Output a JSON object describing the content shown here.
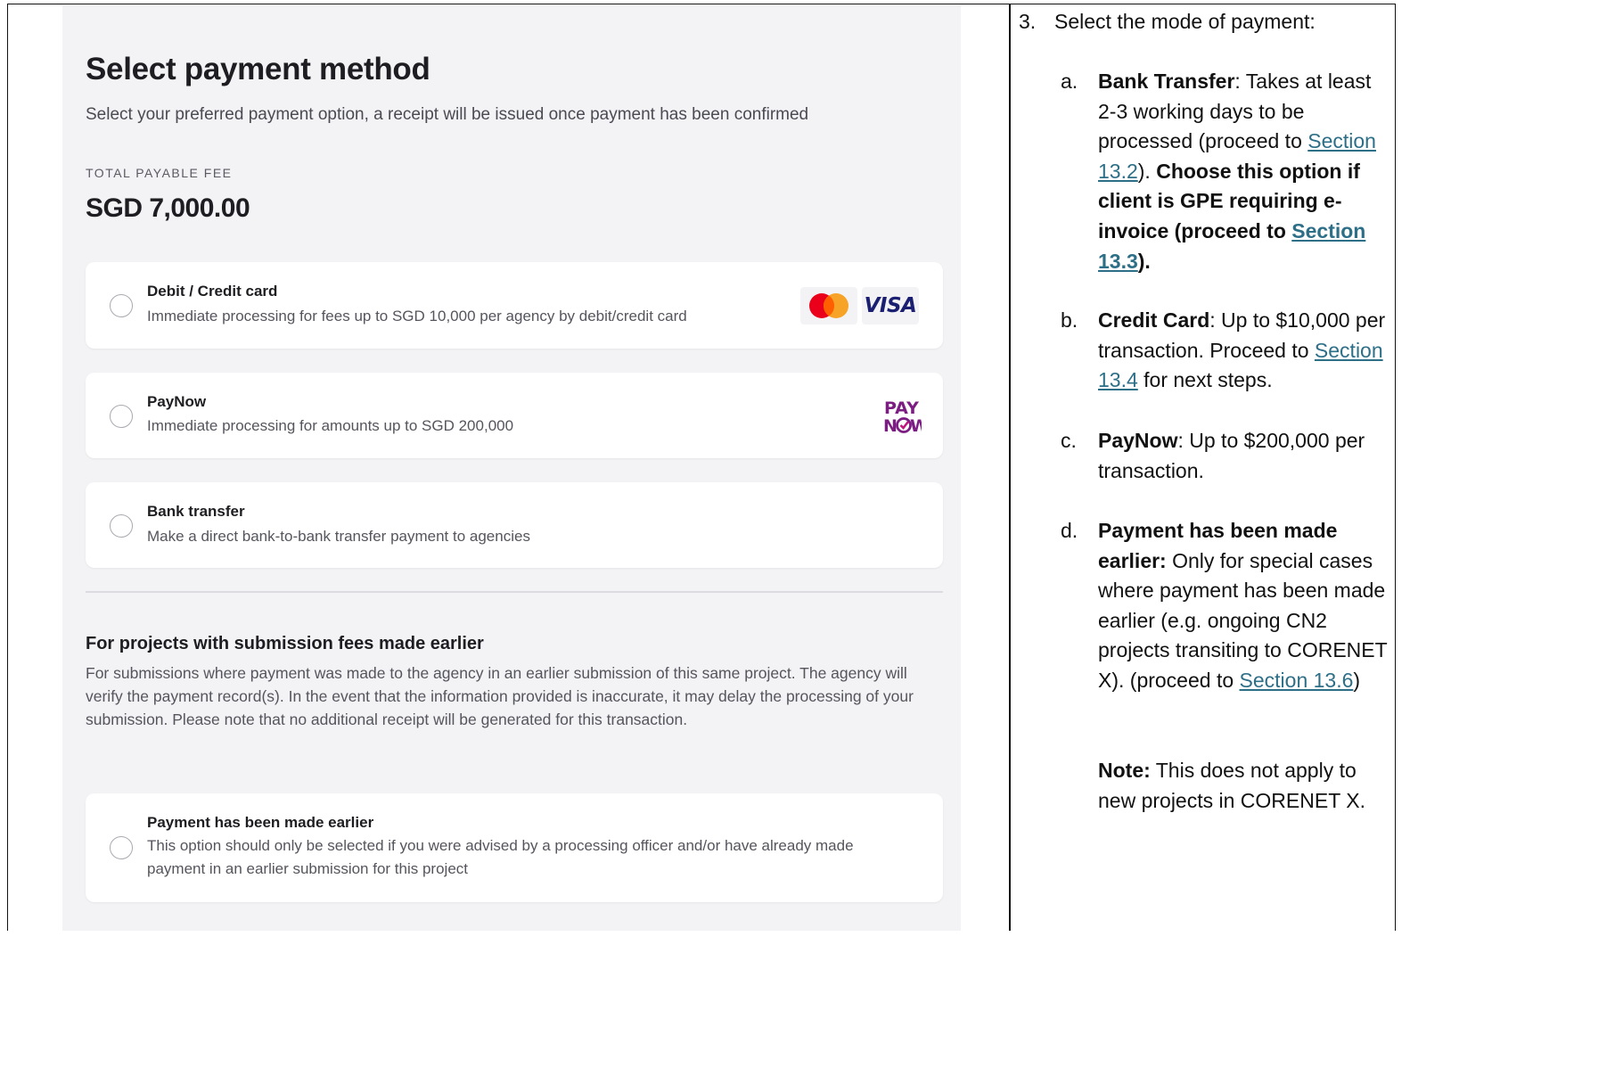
{
  "payment_panel": {
    "title": "Select payment method",
    "subtitle": "Select your preferred payment option, a receipt will be issued once payment has been confirmed",
    "total_label": "TOTAL PAYABLE FEE",
    "total_value": "SGD 7,000.00",
    "options": [
      {
        "title": "Debit / Credit card",
        "description": "Immediate processing for fees up to SGD 10,000 per agency by debit/credit card",
        "selected": false,
        "logos": [
          "mastercard-icon",
          "visa-icon"
        ],
        "visa_text": "VISA"
      },
      {
        "title": "PayNow",
        "description": "Immediate processing for amounts up to SGD 200,000",
        "selected": false,
        "logos": [
          "paynow-icon"
        ],
        "paynow_text_top": "PAY",
        "paynow_text_bottom_left": "N",
        "paynow_text_bottom_right": "W"
      },
      {
        "title": "Bank transfer",
        "description": "Make a direct bank-to-bank transfer payment to agencies",
        "selected": false
      }
    ],
    "earlier_section": {
      "heading": "For projects with submission fees made earlier",
      "description": "For submissions where payment was made to the agency in an earlier submission of this same project. The agency will verify the payment record(s). In the event that the information provided is inaccurate, it may delay the processing of your submission. Please note that no additional receipt will be generated for this transaction.",
      "option": {
        "title": "Payment has been made earlier",
        "description": "This option should only be selected if you were advised by a processing officer and/or have already made payment in an earlier submission for this project",
        "selected": false
      }
    }
  },
  "instructions": {
    "step_number": "3.",
    "step_text": "Select the mode of payment:",
    "items": [
      {
        "marker": "a.",
        "name": "Bank Transfer",
        "text1": ": Takes at least 2-3 working days to be processed (proceed to ",
        "link1": "Section 13.2",
        "text2": "). ",
        "bold_text": "Choose this option if client is GPE requiring e-invoice (proceed to ",
        "link2": "Section 13.3",
        "bold_end": ")."
      },
      {
        "marker": "b.",
        "name": "Credit Card",
        "text1": ": Up to $10,000 per transaction. Proceed to ",
        "link1": "Section 13.4",
        "text2": " for next steps."
      },
      {
        "marker": "c.",
        "name": "PayNow",
        "text1": ": Up to $200,000 per transaction."
      },
      {
        "marker": "d.",
        "name": "Payment has been made earlier:",
        "text1": " Only for special cases where payment has been made earlier (e.g. ongoing CN2 projects transiting to CORENET X). (proceed to ",
        "link1": "Section 13.6",
        "text2": ")"
      }
    ],
    "note_label": "Note:",
    "note_text": " This does not apply to new projects in CORENET X."
  },
  "colors": {
    "link": "#2e6f88",
    "panel_bg": "#f3f3f5",
    "paynow_purple": "#7b1d82",
    "mastercard_red": "#eb001b",
    "mastercard_orange": "#f79e1b",
    "visa_blue": "#1a1f71"
  }
}
